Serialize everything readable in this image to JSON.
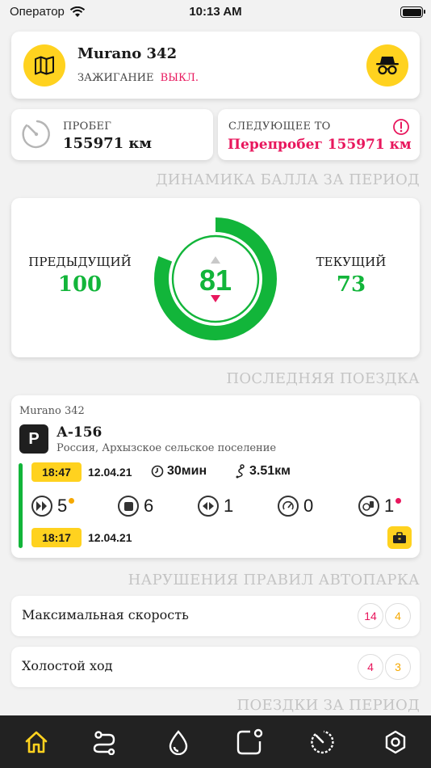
{
  "status_bar": {
    "carrier": "Оператор",
    "time": "10:13 AM"
  },
  "vehicle": {
    "name": "Murano 342",
    "ignition_label": "ЗАЖИГАНИЕ",
    "ignition_value": "ВЫКЛ."
  },
  "mileage": {
    "label": "ПРОБЕГ",
    "value": "155971 км"
  },
  "next_service": {
    "label": "СЛЕДУЮЩЕЕ ТО",
    "value": "Перепробег 155971 км"
  },
  "score": {
    "section_title": "ДИНАМИКА БАЛЛА ЗА ПЕРИОД",
    "previous_label": "ПРЕДЫДУЩИЙ",
    "previous_value": "100",
    "current_label": "ТЕКУЩИЙ",
    "current_value": "73",
    "center_value": "81",
    "gauge_fraction": 0.81
  },
  "last_trip": {
    "section_title": "ПОСЛЕДНЯЯ ПОЕЗДКА",
    "vehicle": "Murano 342",
    "parking_letter": "P",
    "code": "А-156",
    "location": "Россия, Архызское сельское поселение",
    "end_time": "18:47",
    "end_date": "12.04.21",
    "duration": "30мин",
    "distance": "3.51км",
    "start_time": "18:17",
    "start_date": "12.04.21",
    "metrics": [
      {
        "icon": "acceleration-icon",
        "value": "5"
      },
      {
        "icon": "braking-icon",
        "value": "6"
      },
      {
        "icon": "cornering-icon",
        "value": "1"
      },
      {
        "icon": "speed-gauge-icon",
        "value": "0"
      },
      {
        "icon": "phone-usage-icon",
        "value": "1"
      }
    ]
  },
  "violations": {
    "section_title": "НАРУШЕНИЯ ПРАВИЛ АВТОПАРКА",
    "items": [
      {
        "name": "Максимальная скорость",
        "red": "14",
        "yellow": "4"
      },
      {
        "name": "Холостой ход",
        "red": "4",
        "yellow": "3"
      }
    ]
  },
  "trips_period": {
    "section_title": "ПОЕЗДКИ ЗА ПЕРИОД"
  },
  "colors": {
    "yellow": "#ffd21f",
    "green": "#12b53a",
    "pink": "#e8175d",
    "gray_text": "#c4c4c4"
  }
}
